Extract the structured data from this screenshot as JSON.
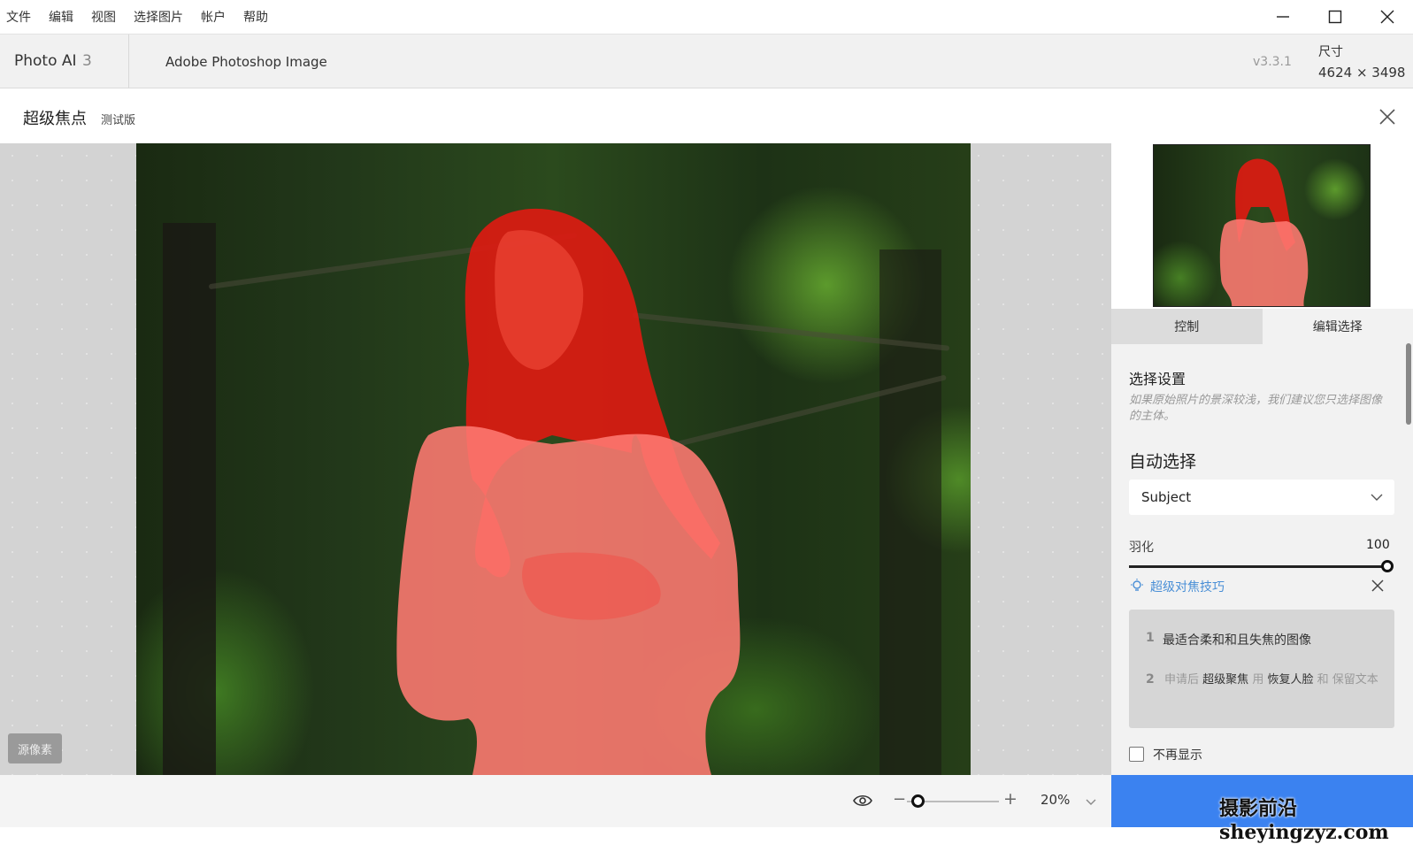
{
  "menu": [
    "文件",
    "编辑",
    "视图",
    "选择图片",
    "帐户",
    "帮助"
  ],
  "app": {
    "name": "Photo AI",
    "version_num": "3",
    "file_name": "Adobe Photoshop Image",
    "version": "v3.3.1",
    "size_label": "尺寸",
    "size_value": "4624 × 3498"
  },
  "tool": {
    "title": "超级焦点",
    "badge": "测试版"
  },
  "canvas": {
    "source_button": "源像素",
    "mask_color": "#ff3030"
  },
  "bottom": {
    "zoom_value": "20%",
    "zoom_fraction": 0.05
  },
  "tabs": [
    {
      "label": "控制",
      "active": false
    },
    {
      "label": "编辑选择",
      "active": true
    }
  ],
  "selection": {
    "title": "选择设置",
    "hint": "如果原始照片的景深较浅，我们建议您只选择图像的主体。",
    "auto_title": "自动选择",
    "auto_value": "Subject",
    "feather_label": "羽化",
    "feather_value": "100",
    "feather_fraction": 1.0
  },
  "tips": {
    "link": "超级对焦技巧",
    "items": [
      {
        "num": "1",
        "text": "最适合柔和和且失焦的图像"
      },
      {
        "num": "2",
        "parts": [
          "申请后",
          "超级聚焦",
          "用",
          "恢复人脸",
          "和 保留文本"
        ]
      }
    ]
  },
  "dont_show": "不再显示",
  "watermark": "摄影前沿 sheyingzyz.com",
  "colors": {
    "accent": "#3b82f0",
    "link": "#4a8fd6"
  }
}
